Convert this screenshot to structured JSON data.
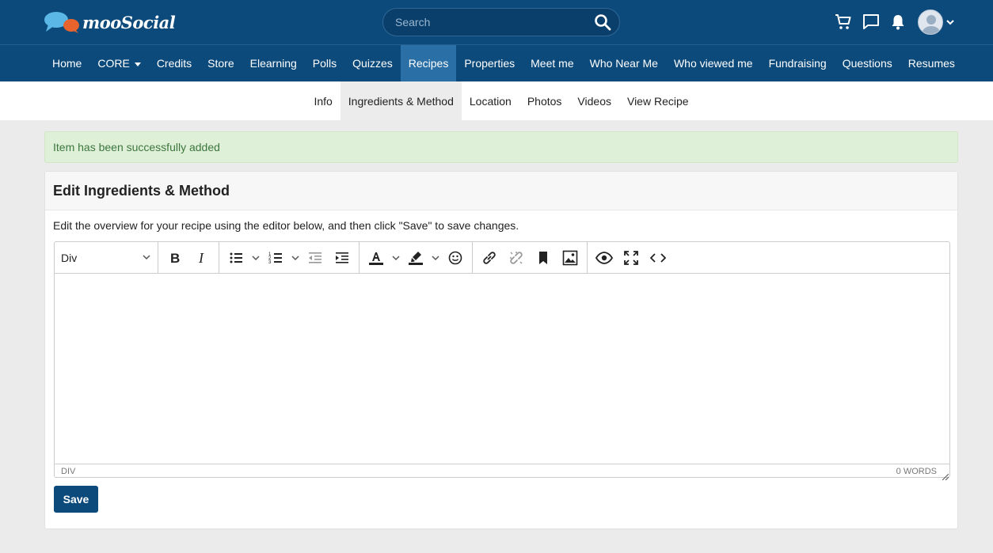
{
  "brand": {
    "name": "mooSocial"
  },
  "search": {
    "placeholder": "Search"
  },
  "header_icons": [
    "search-icon",
    "cart-icon",
    "chat-icon",
    "bell-icon",
    "user-avatar",
    "chevron-down-icon"
  ],
  "main_nav": [
    {
      "label": "Home"
    },
    {
      "label": "CORE"
    },
    {
      "label": "Credits"
    },
    {
      "label": "Store"
    },
    {
      "label": "Elearning"
    },
    {
      "label": "Polls"
    },
    {
      "label": "Quizzes"
    },
    {
      "label": "Recipes"
    },
    {
      "label": "Properties"
    },
    {
      "label": "Meet me"
    },
    {
      "label": "Who Near Me"
    },
    {
      "label": "Who viewed me"
    },
    {
      "label": "Fundraising"
    },
    {
      "label": "Questions"
    },
    {
      "label": "Resumes"
    }
  ],
  "sub_nav": [
    {
      "label": "Info"
    },
    {
      "label": "Ingredients & Method"
    },
    {
      "label": "Location"
    },
    {
      "label": "Photos"
    },
    {
      "label": "Videos"
    },
    {
      "label": "View Recipe"
    }
  ],
  "alert": {
    "text": "Item has been successfully added"
  },
  "panel": {
    "title": "Edit Ingredients & Method",
    "description": "Edit the overview for your recipe using the editor below, and then click \"Save\" to save changes."
  },
  "editor": {
    "block_format": "Div",
    "status_path": "DIV",
    "word_count": "0 WORDS"
  },
  "actions": {
    "save_label": "Save"
  },
  "colors": {
    "brand": "#0d4a7c",
    "nav_active": "#2a6fa6",
    "alert_bg": "#dff0d8",
    "alert_text": "#3c763d"
  }
}
